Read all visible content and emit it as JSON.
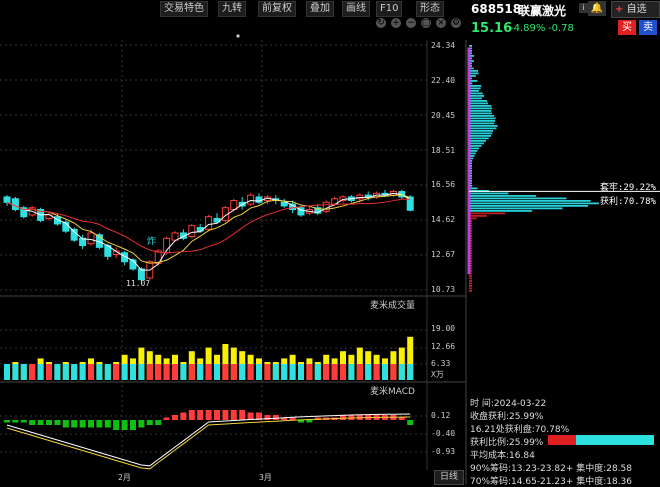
{
  "toolbar": {
    "items": [
      "交易特色",
      "九转",
      "前复权",
      "叠加",
      "画线",
      "F10",
      "形态"
    ]
  },
  "stock": {
    "code": "688518",
    "name": "联赢激光",
    "price": "15.16",
    "change_pct": "-4.89%",
    "change": "-0.78",
    "buy_label": "买",
    "sell_label": "卖",
    "watch_label": "自选",
    "watch_plus": "+"
  },
  "price_axis": [
    "24.34",
    "22.40",
    "20.45",
    "18.51",
    "16.56",
    "14.62",
    "12.67",
    "10.73"
  ],
  "low_marker": "11.07",
  "zha_label": "炸",
  "volume_panel": {
    "title": "麦米成交量",
    "axis": [
      "19.00",
      "12.66",
      "6.33"
    ],
    "unit": "X万"
  },
  "macd_panel": {
    "title": "麦米MACD",
    "axis": [
      "0.12",
      "-0.40",
      "-0.93"
    ]
  },
  "time_axis": [
    "2月",
    "3月"
  ],
  "period_btn": "日线",
  "chip": {
    "loss_label": "套牢:29.22%",
    "profit_label": "获利:70.78%"
  },
  "chip_info": {
    "time": "时     间:2024-03-22",
    "close_profit": "收盘获利:25.99%",
    "line2": "16.21处获利盘:70.78%",
    "profit_ratio": "获利比例:25.99%",
    "avg_cost": "平均成本:16.84",
    "line5": "90%筹码:13.23-23.82+ 集中度:28.58",
    "line6": "70%筹码:14.65-21.23+ 集中度:18.36"
  },
  "colors": {
    "up": "#ff3b3b",
    "down": "#2fe0e0",
    "ma_white": "#ffffff",
    "ma_yellow": "#f2d43a",
    "ma_red": "#e33030",
    "volume_yellow": "#f8f000",
    "chip_cyan": "#29d0d8",
    "chip_purple": "#c040e0",
    "chip_red": "#c02020"
  }
}
